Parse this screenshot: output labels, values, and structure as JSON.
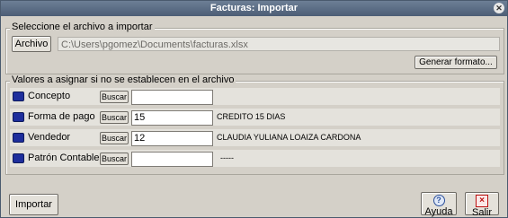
{
  "window": {
    "title": "Facturas: Importar"
  },
  "file_group": {
    "legend": "Seleccione el archivo a importar",
    "archivo_button": "Archivo",
    "file_path": "C:\\Users\\pgomez\\Documents\\facturas.xlsx",
    "generar_button": "Generar formato..."
  },
  "values_group": {
    "legend": "Valores a asignar si no se establecen en el archivo",
    "buscar_label": "Buscar",
    "rows": [
      {
        "label": "Concepto",
        "value": "",
        "description": ""
      },
      {
        "label": "Forma de pago",
        "value": "15",
        "description": "CREDITO 15 DIAS"
      },
      {
        "label": "Vendedor",
        "value": "12",
        "description": "CLAUDIA YULIANA LOAIZA CARDONA"
      },
      {
        "label": "Patrón Contable",
        "value": "",
        "description": "-----"
      }
    ]
  },
  "footer": {
    "importar_button": "Importar",
    "ayuda_button": "Ayuda",
    "salir_button": "Salir"
  },
  "icons": {
    "close": "close-icon",
    "help": "help-icon",
    "exit": "exit-icon",
    "row": "led-icon"
  }
}
